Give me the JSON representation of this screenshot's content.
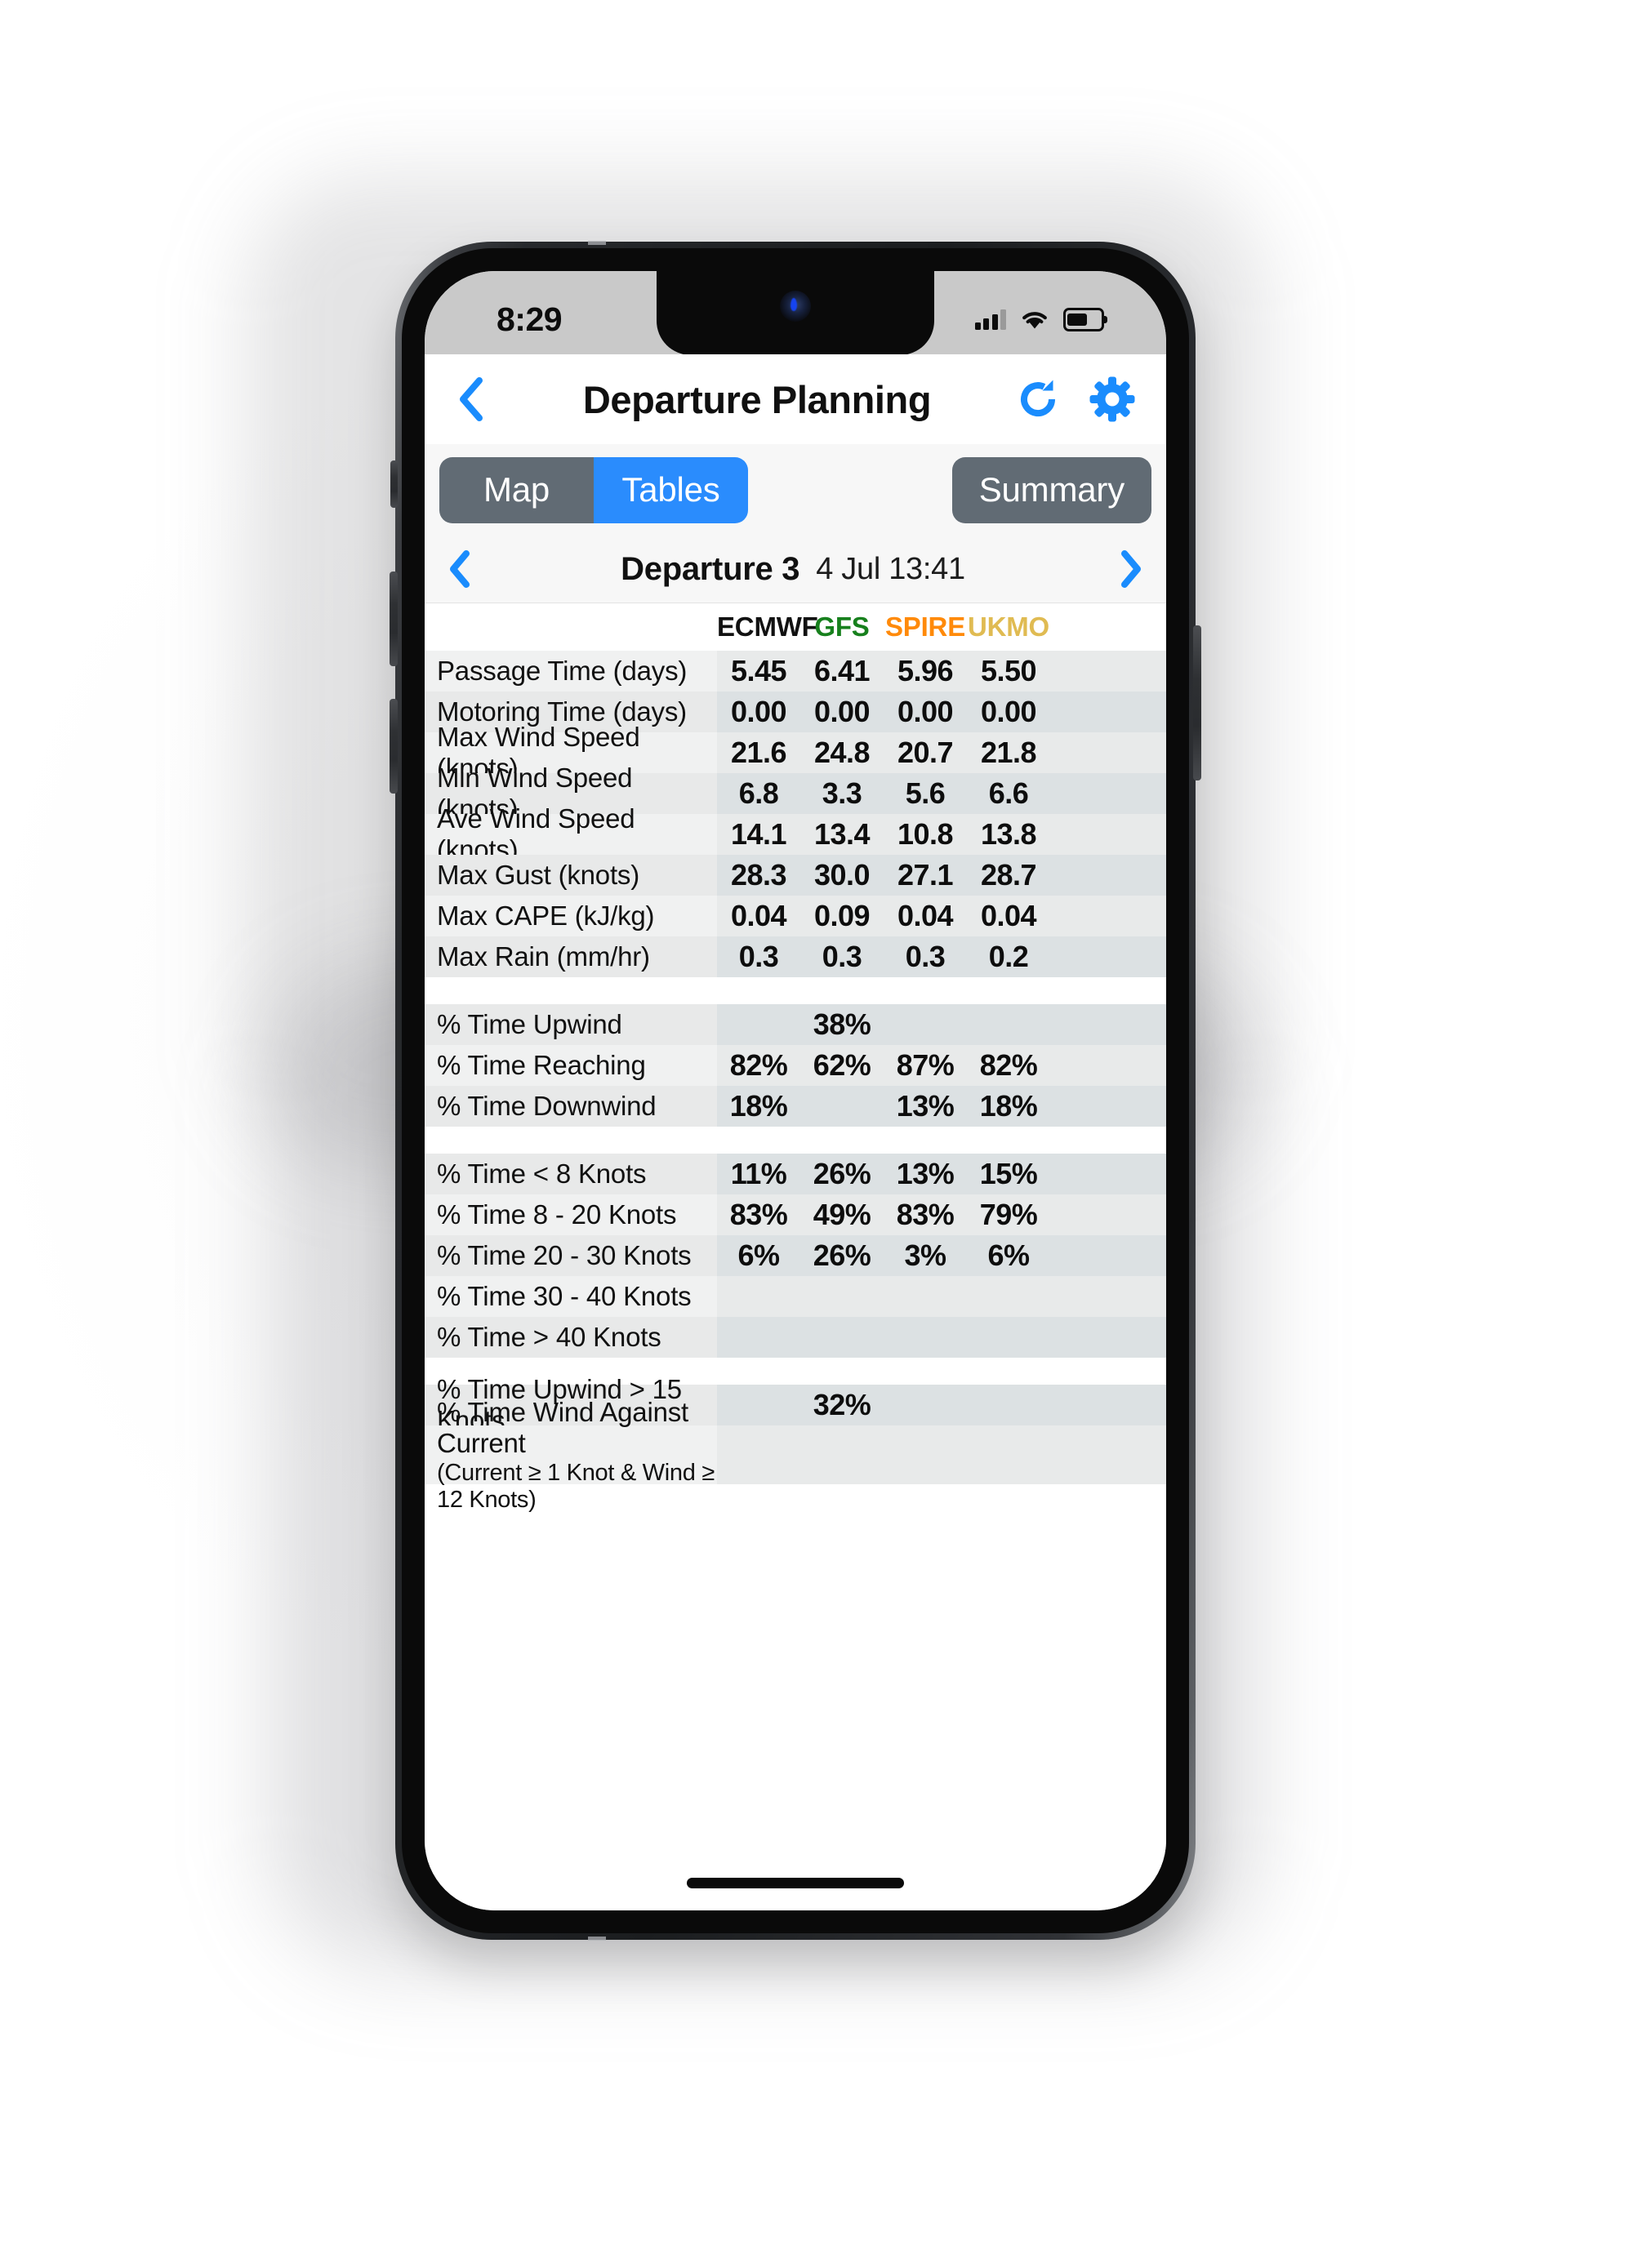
{
  "statusbar": {
    "time": "8:29",
    "signal_icon": "cellular-bars-icon",
    "wifi_icon": "wifi-icon",
    "battery_icon": "battery-icon"
  },
  "navbar": {
    "back_icon": "chevron-left-icon",
    "title": "Departure Planning",
    "refresh_icon": "refresh-icon",
    "settings_icon": "gear-icon"
  },
  "segments": {
    "map_label": "Map",
    "tables_label": "Tables",
    "summary_label": "Summary",
    "active": "Tables",
    "active_color": "#2a8cfd",
    "inactive_color": "#616b74"
  },
  "departure": {
    "prev_icon": "chevron-left-icon",
    "next_icon": "chevron-right-icon",
    "label": "Departure 3",
    "date": "4 Jul 13:41"
  },
  "table": {
    "columns": [
      {
        "name": "ECMWF",
        "color": "#111111"
      },
      {
        "name": "GFS",
        "color": "#17801d"
      },
      {
        "name": "SPIRE",
        "color": "#ff8a0a"
      },
      {
        "name": "UKMO",
        "color": "#e0bb52"
      }
    ],
    "rows": [
      {
        "label": "Passage Time (days)",
        "values": [
          "5.45",
          "6.41",
          "5.96",
          "5.50"
        ]
      },
      {
        "label": "Motoring Time (days)",
        "values": [
          "0.00",
          "0.00",
          "0.00",
          "0.00"
        ]
      },
      {
        "label": "Max Wind Speed (knots)",
        "values": [
          "21.6",
          "24.8",
          "20.7",
          "21.8"
        ]
      },
      {
        "label": "Min Wind Speed (knots)",
        "values": [
          "6.8",
          "3.3",
          "5.6",
          "6.6"
        ]
      },
      {
        "label": "Ave Wind Speed (knots)",
        "values": [
          "14.1",
          "13.4",
          "10.8",
          "13.8"
        ]
      },
      {
        "label": "Max Gust (knots)",
        "values": [
          "28.3",
          "30.0",
          "27.1",
          "28.7"
        ]
      },
      {
        "label": "Max CAPE (kJ/kg)",
        "values": [
          "0.04",
          "0.09",
          "0.04",
          "0.04"
        ]
      },
      {
        "label": "Max Rain (mm/hr)",
        "values": [
          "0.3",
          "0.3",
          "0.3",
          "0.2"
        ]
      },
      {
        "label": "",
        "values": [
          "",
          "",
          "",
          ""
        ],
        "spacer": true
      },
      {
        "label": "% Time Upwind",
        "values": [
          "",
          "38%",
          "",
          ""
        ]
      },
      {
        "label": "% Time Reaching",
        "values": [
          "82%",
          "62%",
          "87%",
          "82%"
        ]
      },
      {
        "label": "% Time Downwind",
        "values": [
          "18%",
          "",
          "13%",
          "18%"
        ]
      },
      {
        "label": "",
        "values": [
          "",
          "",
          "",
          ""
        ],
        "spacer": true
      },
      {
        "label": "% Time < 8 Knots",
        "values": [
          "11%",
          "26%",
          "13%",
          "15%"
        ]
      },
      {
        "label": "% Time 8 - 20 Knots",
        "values": [
          "83%",
          "49%",
          "83%",
          "79%"
        ]
      },
      {
        "label": "% Time 20 - 30 Knots",
        "values": [
          "6%",
          "26%",
          "3%",
          "6%"
        ]
      },
      {
        "label": "% Time 30 - 40 Knots",
        "values": [
          "",
          "",
          "",
          ""
        ]
      },
      {
        "label": "% Time > 40 Knots",
        "values": [
          "",
          "",
          "",
          ""
        ]
      },
      {
        "label": "",
        "values": [
          "",
          "",
          "",
          ""
        ],
        "spacer": true
      },
      {
        "label": "% Time Upwind > 15 Knots",
        "values": [
          "",
          "32%",
          "",
          ""
        ]
      },
      {
        "label": "% Time Wind Against Current",
        "sublabel": "(Current ≥ 1 Knot & Wind ≥ 12 Knots)",
        "values": [
          "",
          "",
          "",
          ""
        ],
        "tall": true
      }
    ]
  }
}
